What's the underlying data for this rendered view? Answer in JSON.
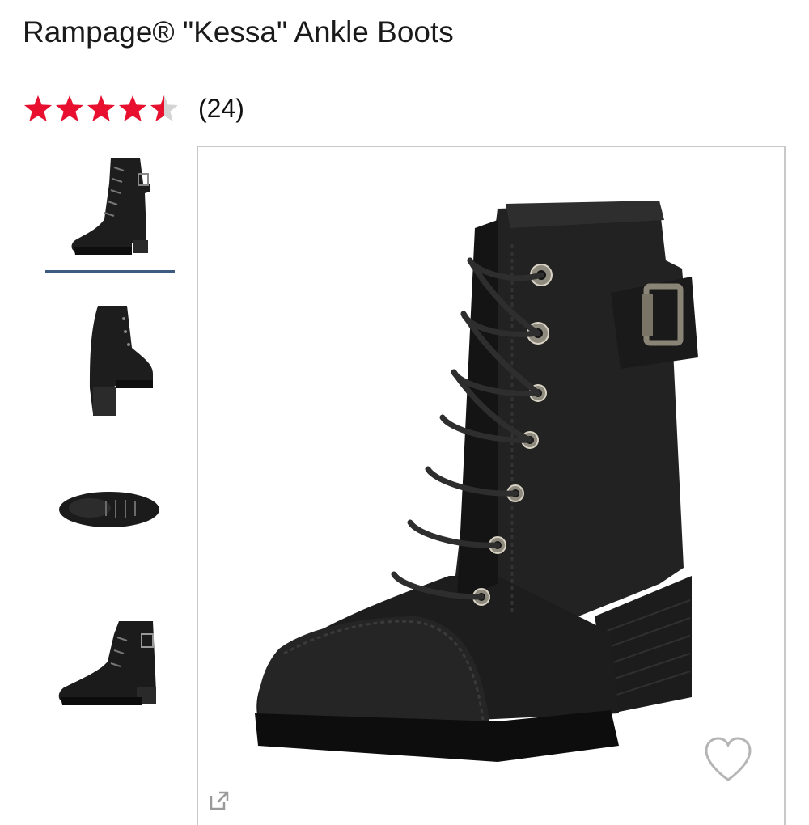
{
  "product": {
    "title": "Rampage® \"Kessa\" Ankle Boots",
    "rating": 4.5,
    "rating_max": 5,
    "review_count": "(24)"
  },
  "colors": {
    "star_filled": "#e8102e",
    "star_empty": "#d4d4d4",
    "thumb_selected_underline": "#3d5a80"
  },
  "gallery": {
    "selected_index": 0,
    "thumbnails": [
      {
        "view": "side-angle"
      },
      {
        "view": "rear-angle"
      },
      {
        "view": "sole-top"
      },
      {
        "view": "side-profile"
      }
    ]
  },
  "icons": {
    "favorite": "heart-icon",
    "expand": "expand-icon"
  }
}
